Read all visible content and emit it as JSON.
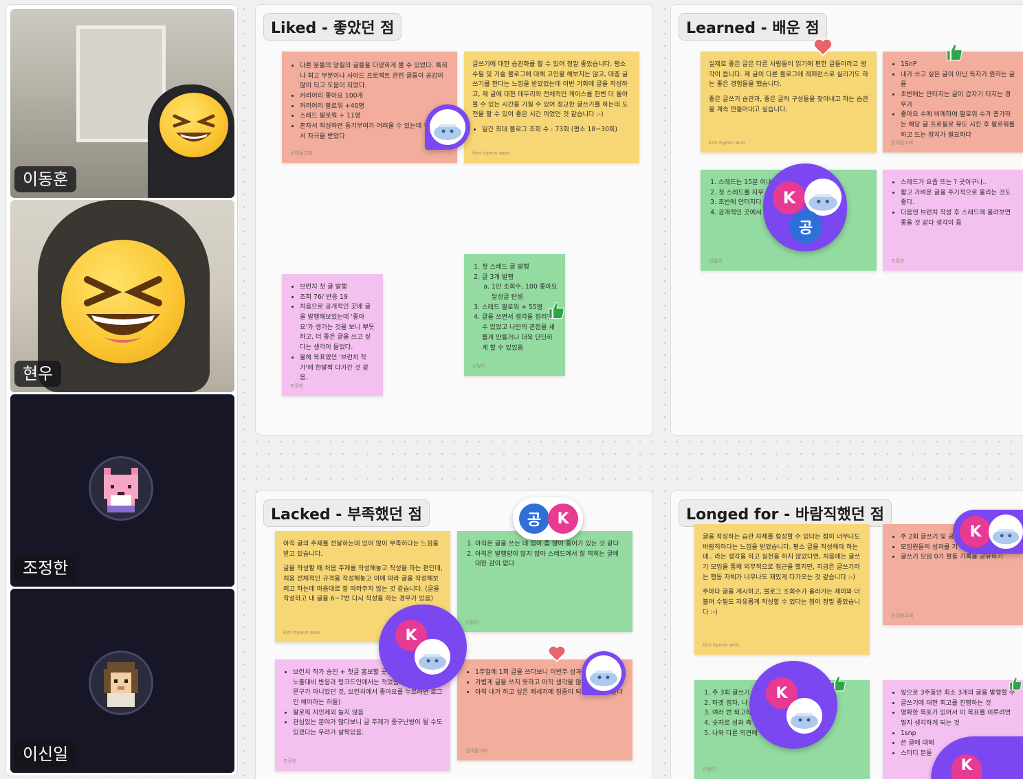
{
  "participants": [
    {
      "name": "이동훈",
      "camera": true
    },
    {
      "name": "현우",
      "camera": true
    },
    {
      "name": "조정한",
      "camera": false,
      "avatar": "fox-pixel-avatar"
    },
    {
      "name": "이신일",
      "camera": false,
      "avatar": "person-pixel-avatar"
    }
  ],
  "board": {
    "frames": [
      {
        "title": "Liked - 좋았던 점"
      },
      {
        "title": "Learned - 배운 점"
      },
      {
        "title": "Lacked - 부족했던 점"
      },
      {
        "title": "Longed for - 바람직했던 점"
      }
    ],
    "liked": {
      "s1": {
        "items": [
          "다른 분들의 양질의 글들을 다양하게 볼 수 있었다. 특히나 회고 부분이나 사이드 프로젝트 관련 글들이 공감이 많이 되고 도움이 되었다.",
          "커리어리 좋아요 100개",
          "커리어리 팔로워 +40명",
          "스레드 팔로워 + 11명",
          "혼자서 작성하면 동기부여가 어려울 수 있는데 진행하면서 자극을 받았다"
        ],
        "author": "공대돌고래"
      },
      "s2": {
        "body": "글쓰기에 대한 습관화를 할 수 있어 정말 좋았습니다. 평소 수필 및 기술 블로그에 대해 고민을 해보지는 않고, 대충 글쓰기를 한다는 느낌을 받았었는데 이번 기회에 글을 작성하고, 제 글에 대한 테두리와 전체적인 케이스를 한번 더 돌아볼 수 있는 시간을 가질 수 있어 정교한 글쓰기를 하는데 도전을 할 수 있어 좋은 시간 이었던 것 같습니다 :-)",
        "items": [
          "일간 최대 블로그 조회 수 : 73회 (평소 18~30회)"
        ],
        "author": "kim hyeon woo"
      },
      "s3": {
        "items": [
          "브런치 첫 글 발행",
          "조회 76/ 반응 19",
          "처음으로 공개적인 곳에 글을 발행해보았는데 '좋아요'가 생기는 것을 보니 뿌듯하고, 더 좋은 글을 쓰고 싶다는 생각이 들었다.",
          "올해 목표였던 '브런치 작가'에 한발짝 다가간 것 같음."
        ],
        "author": "조정한"
      },
      "s4": {
        "items": [
          "첫 스레드 글 발행",
          "글 3개 발행",
          "스레드 팔로워 + 55명",
          "글을 쓰면서 생각을 정리할 수 있었고 나만의 관점을 새롭게 만들거나 더욱 단단하게 할 수 있었음"
        ],
        "sub": "1만 조회수, 100 좋아요 달성글 탄생",
        "author": "신일이"
      }
    },
    "learned": {
      "s1": {
        "p1": "실제로 좋은 글은 다른 사람들이 읽기에 편한 글들이라고 생각이 듭니다. 제 글이 다른 블로그에 레퍼런스로 실리기도 하는 좋은 경험들을 했습니다.",
        "p2": "좋은 글쓰기 습관과, 좋은 글의 구성들을 찾아내고 하는 습관을 계속 만들어내고 싶습니다.",
        "author": "kim hyeon woo"
      },
      "s2": {
        "items": [
          "1SnP",
          "내가 쓰고 싶은 글이 아닌 독자가 원하는 글을",
          "초반에는 안터지는 글이 갑자기 터지는 경우가",
          "좋아요 수에 비례하여 팔로워 수가 증가하는 해당 글 프로필로 유도 시킨 후 팔로워를 하고 드는 장치가 필요하다"
        ],
        "author": "공대돌고래"
      },
      "s3": {
        "items": [
          "스레드는 15분 이내",
          "첫 스레드를 지우 잘 못타는 것 같다(?)",
          "초반에 안터지다 한다",
          "공개적인 곳에서 용할 준비가 되어 있어야"
        ],
        "author": "신일이"
      },
      "s4": {
        "items": [
          "스레드가 요즘 뜨는 ? 곳이구나..",
          "짧고 가벼운 글을 주기적으로 올리는 것도 좋다.",
          "다음엔 브런치 작성 후 스레드에 올려보면 좋을 것 같다 생각이 듦"
        ],
        "author": "조정한"
      }
    },
    "lacked": {
      "s1": {
        "p1": "아직 글의 주제를 전달하는데 있어 많이 부족하다는 느낌을 받고 있습니다.",
        "p2": "글을 작성할 때 처음 주제를 작성해놓고 작성을 하는 편인데, 처음 전체적인 규격을 작성해놓고 이에 따라 글을 작성해보려고 하는데 마음대로 잘 따라주지 않는 것 같습니다. (글을 작성하고 내 글을 6~7번 다시 작성을 하는 경우가 있음)",
        "author": "kim hyeon woo"
      },
      "s2": {
        "items": [
          "아직은 글을 쓰는 데 힘이 좀 많이 들어가 있는 것 같다",
          "아직은 발행량이 많지 않아 스레드에서 잘 먹히는 글에 대한 감이 없다"
        ],
        "author": "신일이"
      },
      "s3": {
        "items": [
          "브런치 작가 승인 + 첫글 홍보할 곳을 찾아 공유했는데, 노출대비 반응과 링크드인에서는 적었음. (링크드인 한 문구가 아니었던 것, 브런치에서 좋아요를 누르려면 로그인 해야하는 허들)",
          "팔로워 지인제외 늘지 않음",
          "관심있는 분야가 많다보니 글 주제가 중구난방이 될 수도 있겠다는 우려가 살짝있음."
        ],
        "author": "조정한"
      },
      "s4": {
        "items": [
          "1주일에 1회 글을 쓰다보니 이번주 성과가 명",
          "가볍게 글을 쓰지 못하고 아직 생각을 많이 하는 것 같다",
          "아직 내가 하고 싶은 메세지에 집중이 되어 있는 것 같다"
        ],
        "author": "공대돌고래"
      }
    },
    "longed": {
      "s1": {
        "p1": "글을 작성하는 습관 자체를 형성할 수 있다는 점이 너무나도 바람직하다는 느낌을 받았습니다. 평소 글을 작성해야 하는데.. 라는 생각을 하고 실천을 하지 않았다면, 처음에는 글쓰기 모임을 통해 의무적으로 접근을 했지만, 지금은 글쓰기라는 행동 자체가 너무나도 재밌게 다가오는 것 같습니다 :-)",
        "p2": "주마다 글을 게시하고, 블로그 조회수가 올라가는 재미와 더불어 수필도 자유롭게 작성할 수 있다는 점이 정말 좋았습니다 :-)",
        "author": "kim hyeon woo"
      },
      "s2": {
        "items": [
          "주 2회 글쓰기 및 공",
          "모임원들의 성과를 기",
          "글쓰기 모임 0기 활동 기록을 공유하기"
        ],
        "author": "공대돌고래"
      },
      "s3": {
        "items": [
          "주 3회 글쓰기",
          "타겟 정자, 나",
          "여러 번 퇴고하",
          "숫자로 성과 측",
          "나와 다른 의견에"
        ],
        "author": "신일이"
      },
      "s4": {
        "items": [
          "앞으로 3주동안 최소 3개의 글을 발행할 수",
          "글쓰기에 대한 회고를 진행하는 것",
          "명확한 목표가 있어서 이 목표를 이루려면 멀지 생각하게 되는 것",
          "1snp",
          "쓴 글에 대해",
          "스터디 분들"
        ]
      }
    },
    "cursors": {
      "k": "K",
      "gong": "공"
    }
  }
}
